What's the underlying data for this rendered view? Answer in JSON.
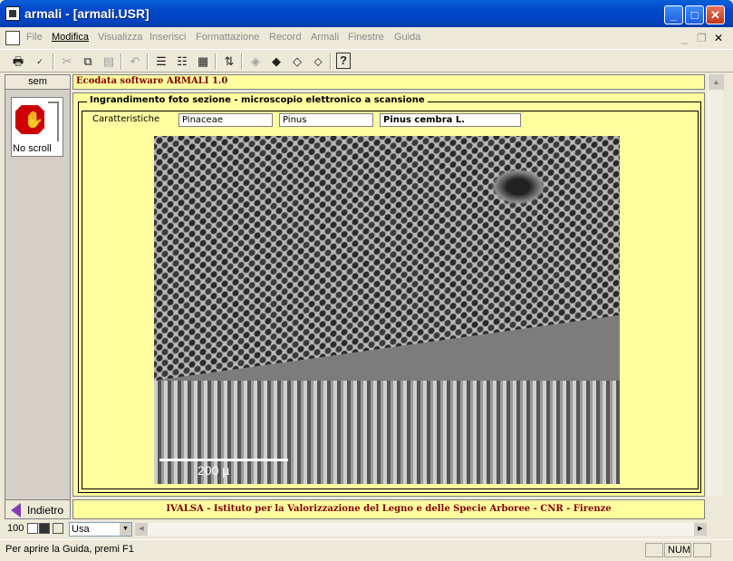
{
  "window": {
    "title": "armali - [armali.USR]"
  },
  "menu": [
    "File",
    "Modifica",
    "Visualizza",
    "Inserisci",
    "Formattazione",
    "Record",
    "Armali",
    "Finestre",
    "Guida"
  ],
  "left": {
    "tab_label": "sem",
    "stop_label": "No scroll",
    "back_label": "Indietro"
  },
  "header": {
    "title": "Ecodata software ARMALI 1.0"
  },
  "group": {
    "title": "Ingrandimento foto sezione - microscopio elettronico a scansione",
    "characteristics_label": "Caratteristiche",
    "family": "Pinaceae",
    "genus": "Pinus",
    "species": "Pinus cembra L."
  },
  "photo": {
    "scale_label": "200 µ"
  },
  "footer": {
    "text": "IVALSA - Istituto per la Valorizzazione del Legno e delle Specie Arboree - CNR - Firenze"
  },
  "bottom": {
    "zoom": "100",
    "combo_value": "Usa"
  },
  "status": {
    "text": "Per aprire la Guida, premi F1",
    "num": "NUM"
  }
}
